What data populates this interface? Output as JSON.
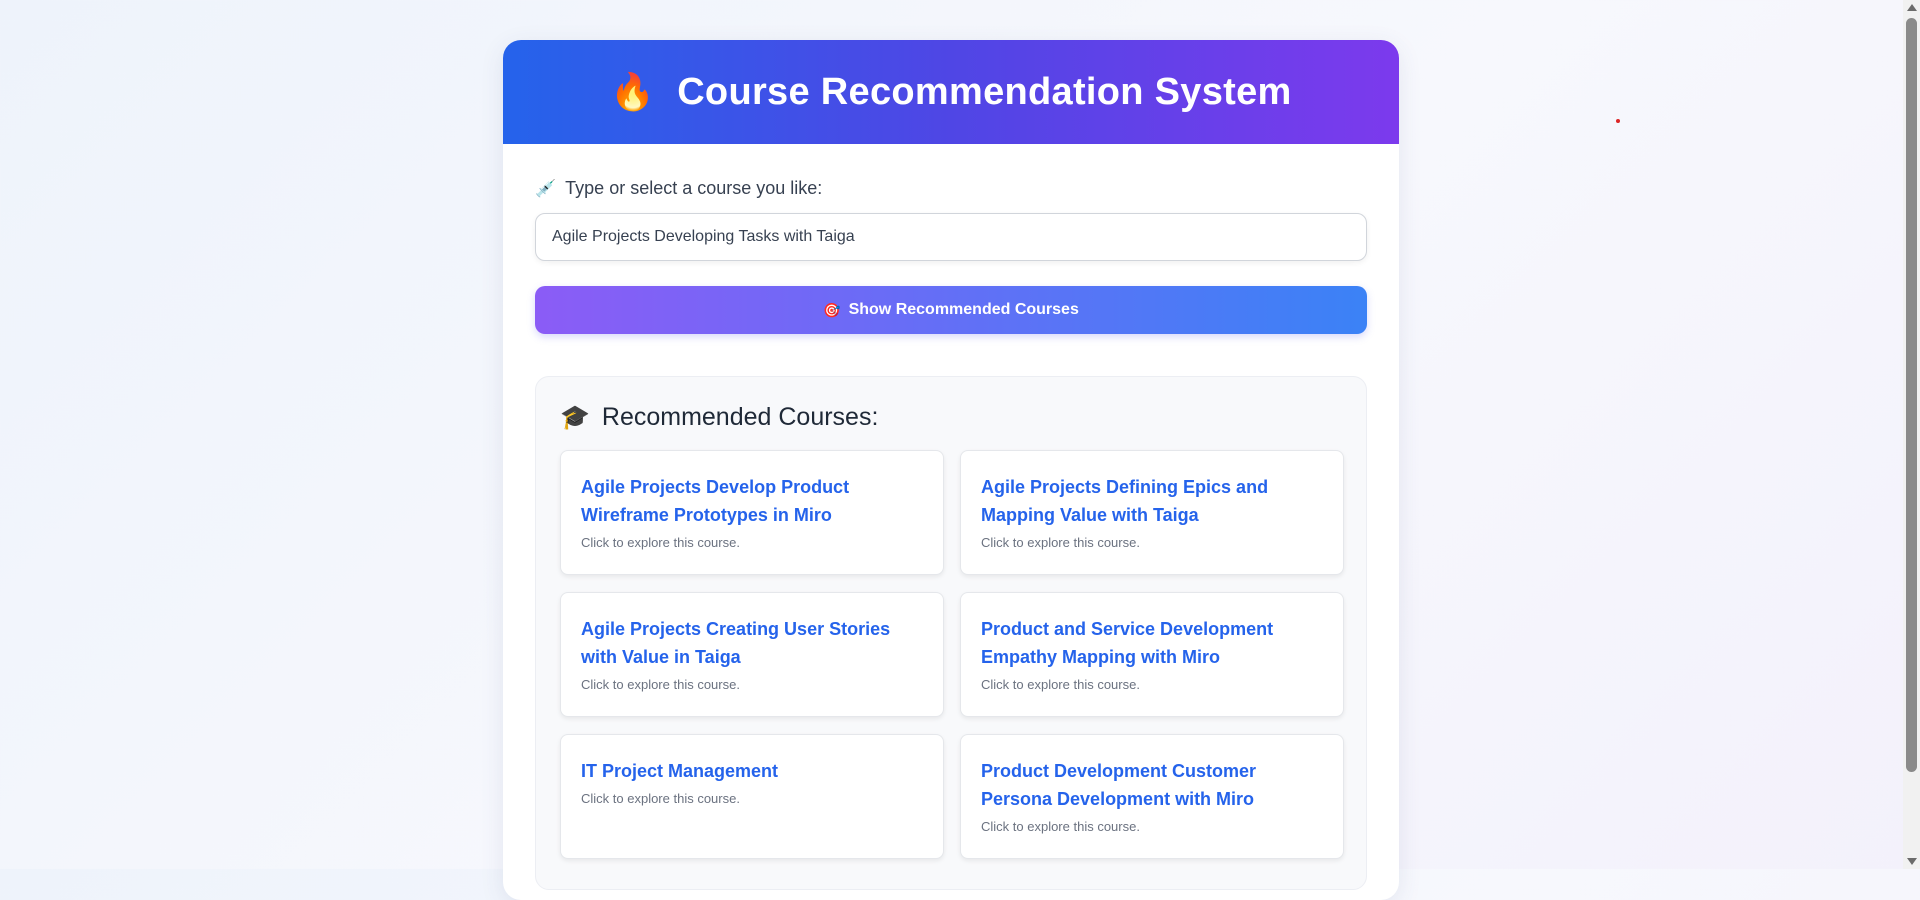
{
  "header": {
    "icon": "fire-emoji",
    "icon_glyph": "🔥",
    "title": "Course Recommendation System"
  },
  "search": {
    "label_icon_glyph": "💉",
    "label": "Type or select a course you like:",
    "value": "Agile Projects Developing Tasks with Taiga"
  },
  "action": {
    "icon_glyph": "🎯",
    "label": "Show Recommended Courses"
  },
  "results": {
    "icon_glyph": "🎓",
    "title": "Recommended Courses:",
    "courses": [
      {
        "title": "Agile Projects Develop Product Wireframe Prototypes in Miro",
        "subtitle": "Click to explore this course."
      },
      {
        "title": "Agile Projects Defining Epics and Mapping Value with Taiga",
        "subtitle": "Click to explore this course."
      },
      {
        "title": "Agile Projects Creating User Stories with Value in Taiga",
        "subtitle": "Click to explore this course."
      },
      {
        "title": "Product and Service Development Empathy Mapping with Miro",
        "subtitle": "Click to explore this course."
      },
      {
        "title": "IT Project Management",
        "subtitle": "Click to explore this course."
      },
      {
        "title": "Product Development Customer Persona Development with Miro",
        "subtitle": "Click to explore this course."
      }
    ]
  },
  "colors": {
    "header_gradient_start": "#2563eb",
    "header_gradient_end": "#7c3aed",
    "button_gradient_start": "#8b5cf6",
    "button_gradient_end": "#3b82f6",
    "course_title": "#2563eb"
  }
}
